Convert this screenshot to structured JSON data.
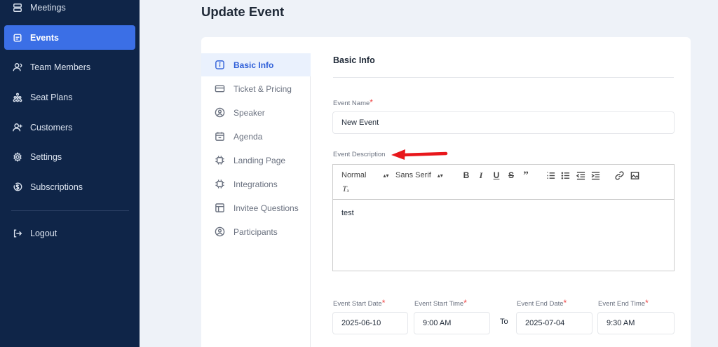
{
  "sidebar": {
    "items": [
      {
        "label": "Meetings",
        "icon": "server-icon"
      },
      {
        "label": "Events",
        "icon": "calendar-icon"
      },
      {
        "label": "Team Members",
        "icon": "users-icon"
      },
      {
        "label": "Seat Plans",
        "icon": "seats-icon"
      },
      {
        "label": "Customers",
        "icon": "user-plus-icon"
      },
      {
        "label": "Settings",
        "icon": "gear-icon"
      },
      {
        "label": "Subscriptions",
        "icon": "dollar-icon"
      }
    ],
    "logout": "Logout",
    "active_color": "#3b6fe6",
    "bg_color": "#0f2548"
  },
  "page": {
    "title": "Update Event"
  },
  "tabs": [
    {
      "label": "Basic Info"
    },
    {
      "label": "Ticket & Pricing"
    },
    {
      "label": "Speaker"
    },
    {
      "label": "Agenda"
    },
    {
      "label": "Landing Page"
    },
    {
      "label": "Integrations"
    },
    {
      "label": "Invitee Questions"
    },
    {
      "label": "Participants"
    }
  ],
  "form": {
    "section_title": "Basic Info",
    "event_name_label": "Event Name",
    "event_name_value": "New Event",
    "description_label": "Event Description",
    "description_text": "test",
    "toolbar": {
      "format": "Normal",
      "font": "Sans Serif"
    },
    "start_date_label": "Event Start Date",
    "start_date_value": "2025-06-10",
    "start_time_label": "Event Start Time",
    "start_time_value": "9:00 AM",
    "to_label": "To",
    "end_date_label": "Event End Date",
    "end_date_value": "2025-07-04",
    "end_time_label": "Event End Time",
    "end_time_value": "9:30 AM",
    "required_mark": "*"
  }
}
